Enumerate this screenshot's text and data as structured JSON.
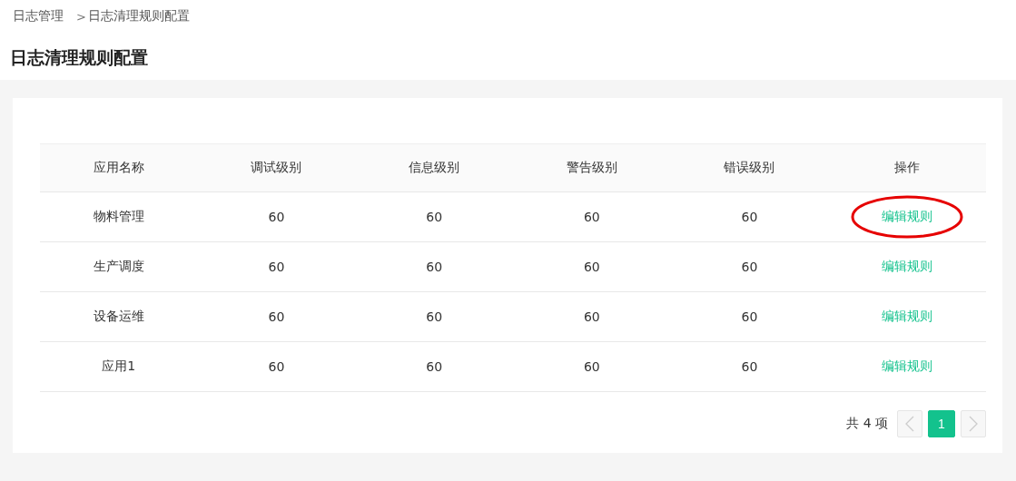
{
  "breadcrumb": {
    "items": [
      {
        "label": "日志管理"
      },
      {
        "label": "日志清理规则配置"
      }
    ],
    "separator": ">"
  },
  "title": "日志清理规则配置",
  "table": {
    "columns": [
      "应用名称",
      "调试级别",
      "信息级别",
      "警告级别",
      "错误级别",
      "操作"
    ],
    "rows": [
      {
        "cells": [
          "物料管理",
          "60",
          "60",
          "60",
          "60"
        ],
        "action": "编辑规则",
        "circled": true
      },
      {
        "cells": [
          "生产调度",
          "60",
          "60",
          "60",
          "60"
        ],
        "action": "编辑规则",
        "circled": false
      },
      {
        "cells": [
          "设备运维",
          "60",
          "60",
          "60",
          "60"
        ],
        "action": "编辑规则",
        "circled": false
      },
      {
        "cells": [
          "应用1",
          "60",
          "60",
          "60",
          "60"
        ],
        "action": "编辑规则",
        "circled": false
      }
    ]
  },
  "pagination": {
    "total": "共 4 项",
    "prev_disabled": true,
    "next_disabled": true,
    "pages": [
      {
        "label": "1",
        "selected": true
      }
    ]
  }
}
